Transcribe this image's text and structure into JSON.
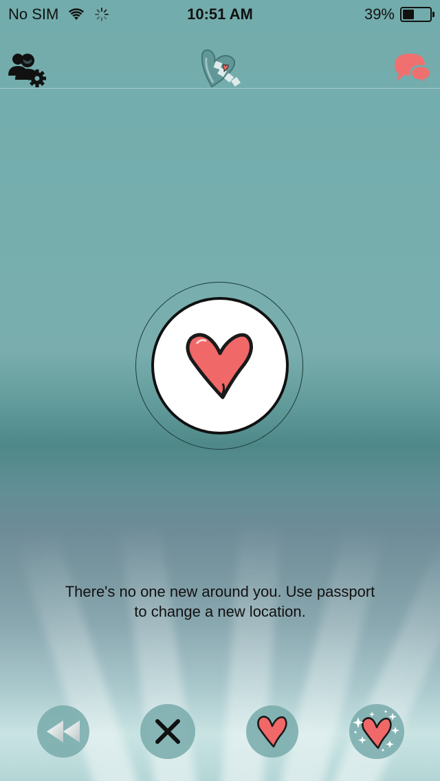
{
  "status_bar": {
    "carrier": "No SIM",
    "time": "10:51 AM",
    "battery_percent": "39%",
    "battery_level": 0.39
  },
  "nav": {
    "left_icon": "profile-settings-icon",
    "center_icon": "app-logo",
    "right_icon": "chat-bubbles-icon",
    "chat_color": "#f07070"
  },
  "main": {
    "center_icon": "heart-icon",
    "empty_message_line1": "There's no one new around you. Use passport",
    "empty_message_line2": "to change a new location."
  },
  "actions": [
    {
      "icon": "rewind-icon"
    },
    {
      "icon": "close-icon"
    },
    {
      "icon": "heart-icon"
    },
    {
      "icon": "sparkle-heart-icon"
    }
  ],
  "colors": {
    "heart": "#f06868",
    "accent": "#78aaaa"
  }
}
